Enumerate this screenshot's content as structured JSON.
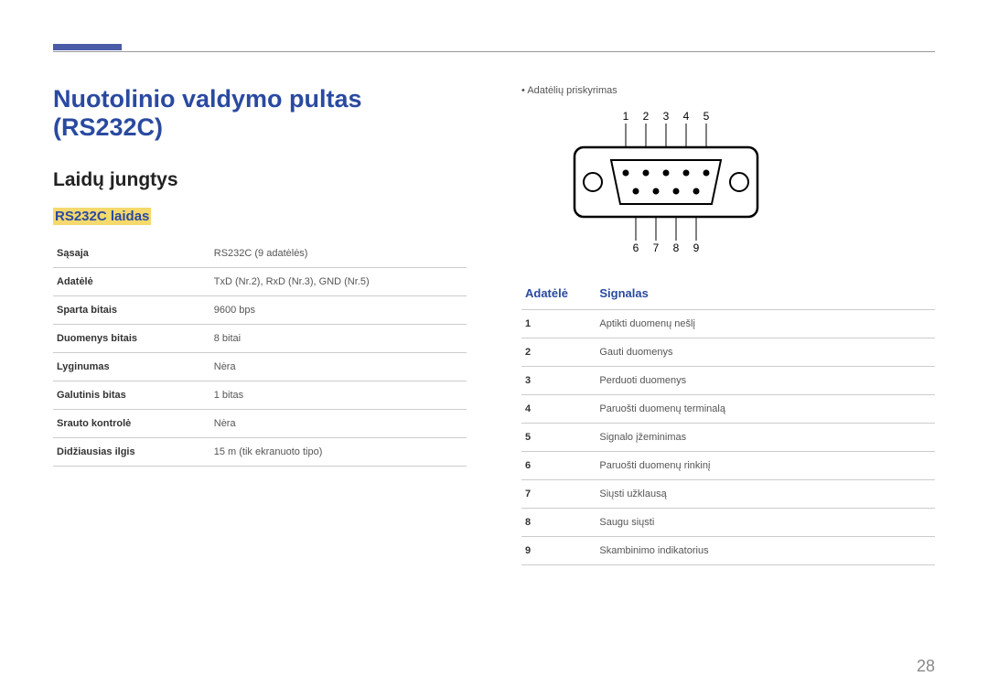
{
  "page_number": "28",
  "title": "Nuotolinio valdymo pultas (RS232C)",
  "section": "Laidų jungtys",
  "subsection": "RS232C laidas",
  "spec": [
    {
      "label": "Sąsaja",
      "value": "RS232C (9 adatėlės)"
    },
    {
      "label": "Adatėlė",
      "value": "TxD (Nr.2), RxD (Nr.3), GND (Nr.5)"
    },
    {
      "label": "Sparta bitais",
      "value": "9600 bps"
    },
    {
      "label": "Duomenys bitais",
      "value": "8 bitai"
    },
    {
      "label": "Lyginumas",
      "value": "Nėra"
    },
    {
      "label": "Galutinis bitas",
      "value": "1 bitas"
    },
    {
      "label": "Srauto kontrolė",
      "value": "Nėra"
    },
    {
      "label": "Didžiausias ilgis",
      "value": "15 m (tik ekranuoto tipo)"
    }
  ],
  "pin_note": "Adatėlių priskyrimas",
  "pin_header_a": "Adatėlė",
  "pin_header_b": "Signalas",
  "chart_data": {
    "type": "table",
    "title": "DB9 connector pin assignment",
    "top_labels": [
      "1",
      "2",
      "3",
      "4",
      "5"
    ],
    "bottom_labels": [
      "6",
      "7",
      "8",
      "9"
    ],
    "pins": [
      {
        "n": "1",
        "sig": "Aptikti duomenų nešlį"
      },
      {
        "n": "2",
        "sig": "Gauti duomenys"
      },
      {
        "n": "3",
        "sig": "Perduoti duomenys"
      },
      {
        "n": "4",
        "sig": "Paruošti duomenų terminalą"
      },
      {
        "n": "5",
        "sig": "Signalo įžeminimas"
      },
      {
        "n": "6",
        "sig": "Paruošti duomenų rinkinį"
      },
      {
        "n": "7",
        "sig": "Siųsti užklausą"
      },
      {
        "n": "8",
        "sig": "Saugu siųsti"
      },
      {
        "n": "9",
        "sig": "Skambinimo indikatorius"
      }
    ]
  }
}
